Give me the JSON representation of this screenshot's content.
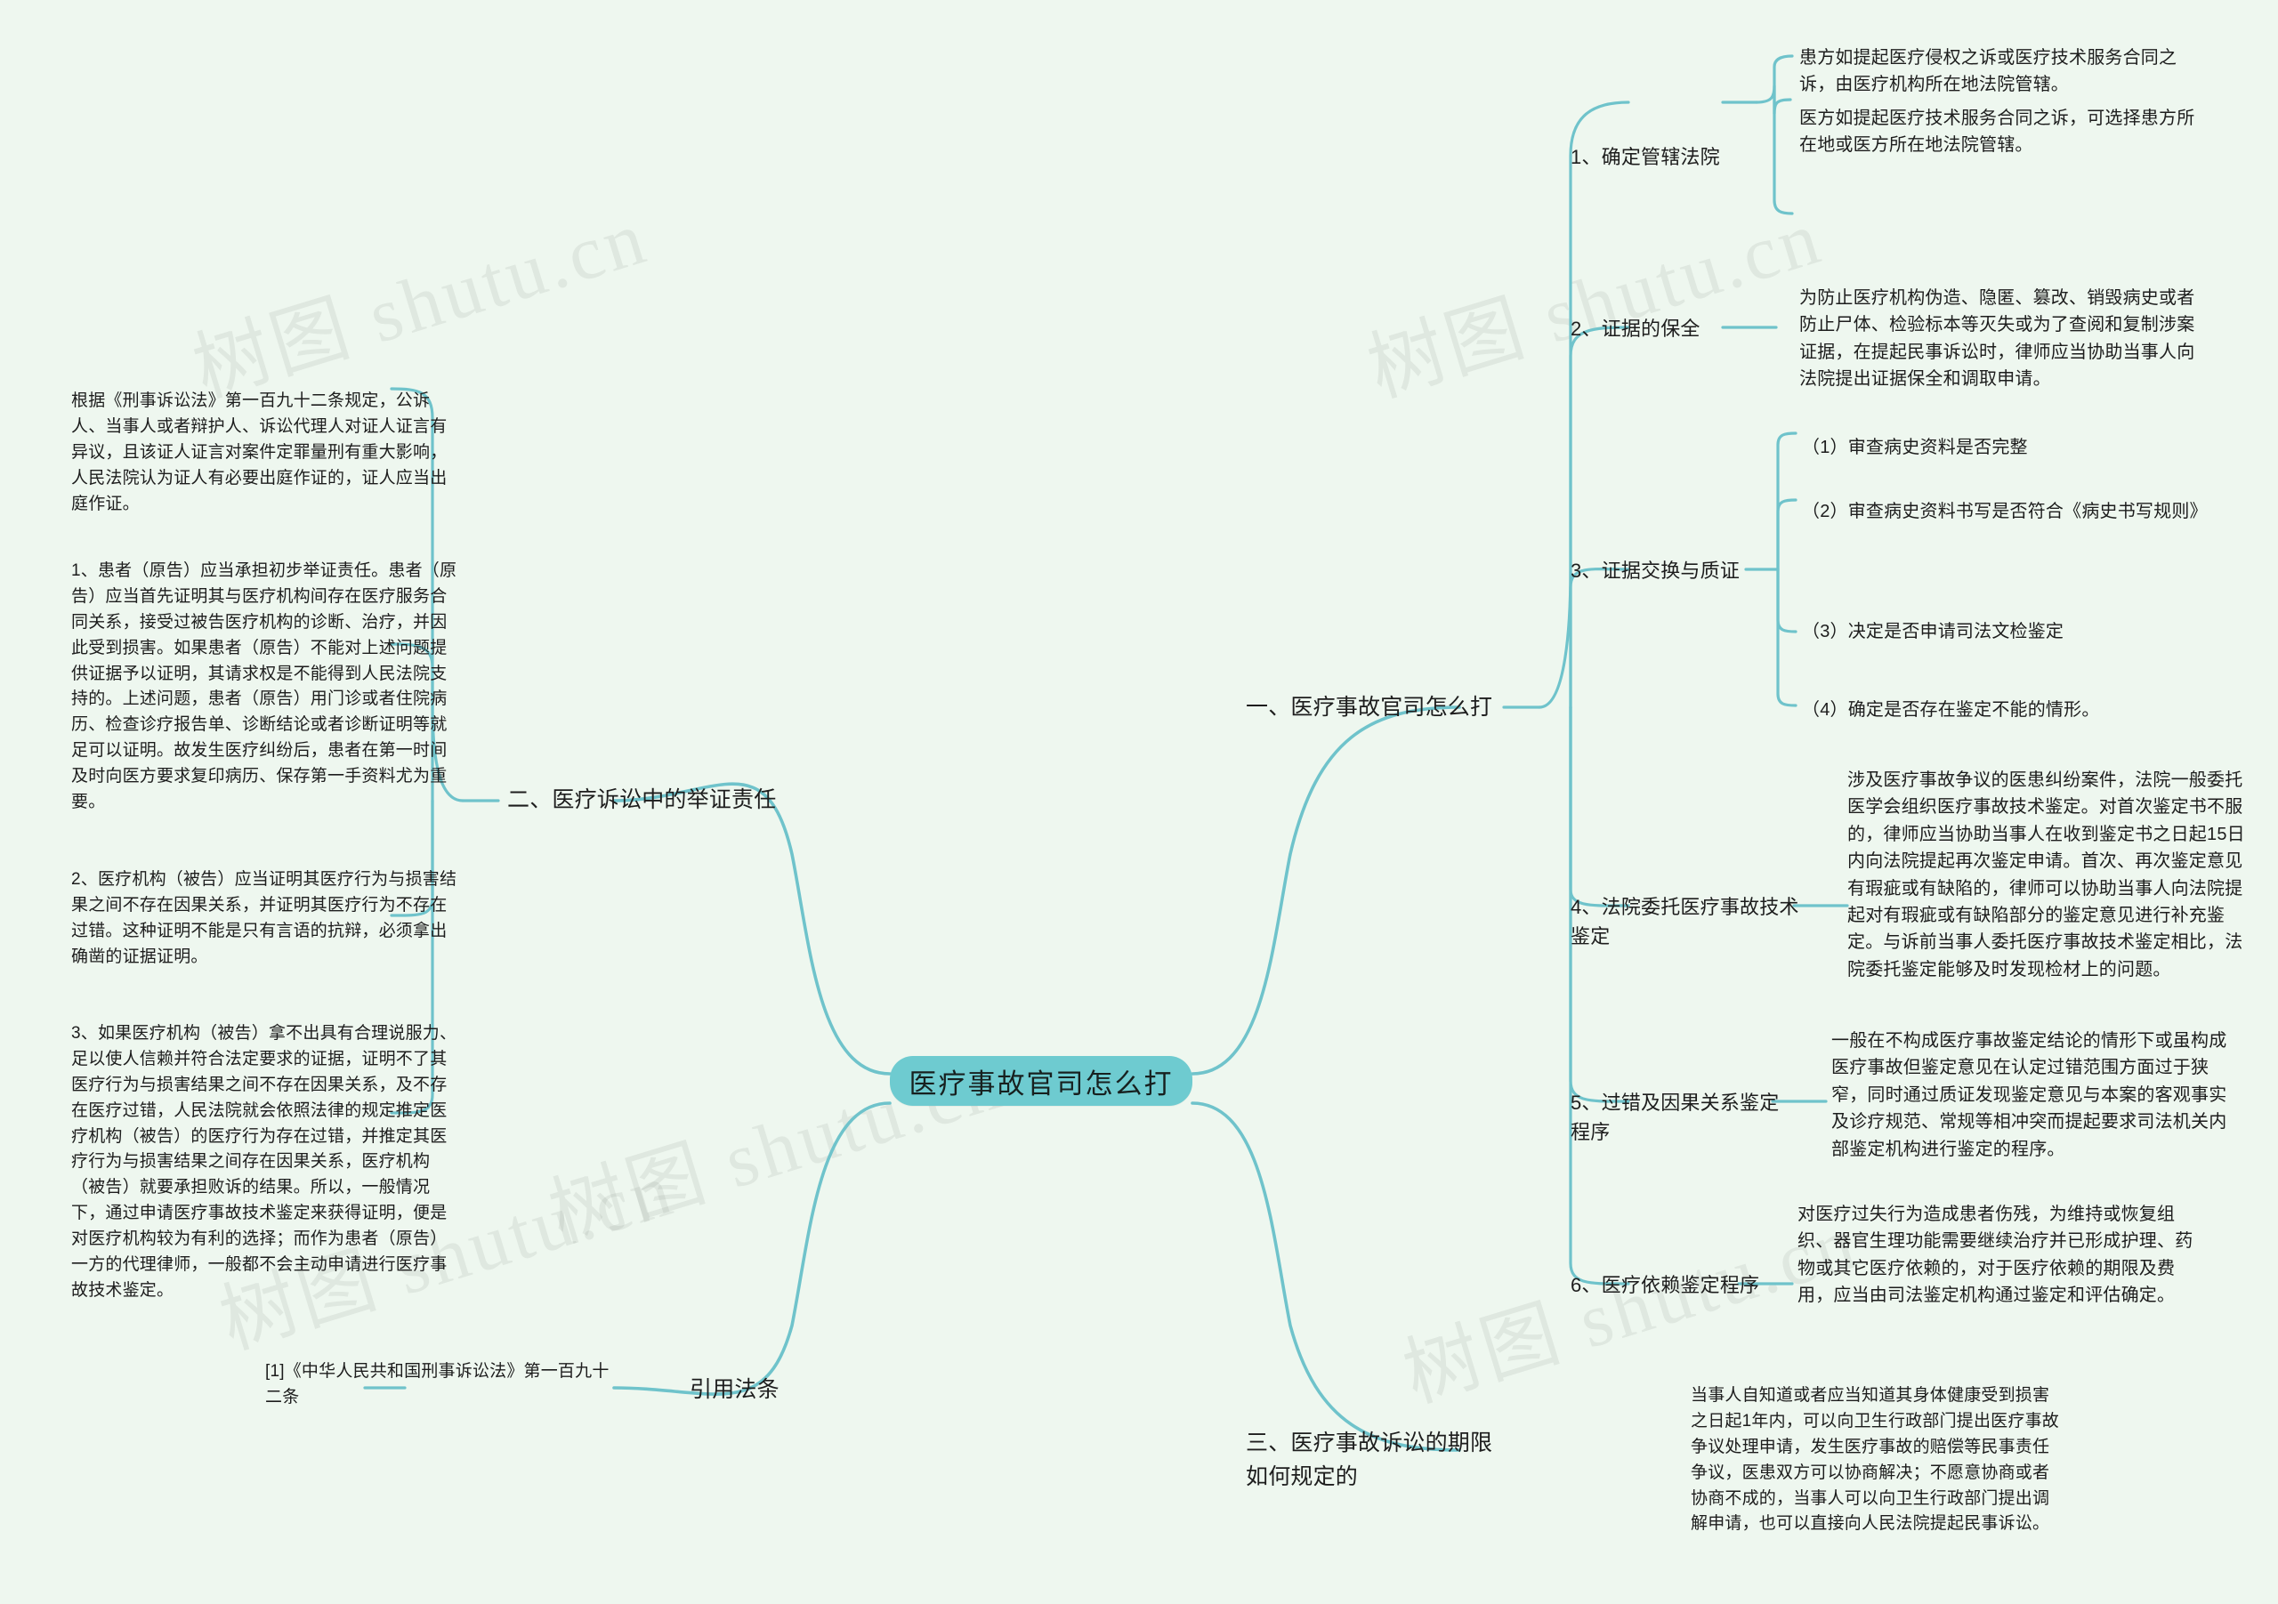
{
  "theme": {
    "background": "#eef7ef",
    "branch_color": "#6fc3cb",
    "central_fill": "#6ecbd0",
    "text_color": "#1d1d1d"
  },
  "watermarks": [
    "树图 shutu.cn",
    "树图 shutu.cn",
    "树图 shutu.cn",
    "树图 shutu.cn",
    "树图 shutu.cn"
  ],
  "central": {
    "label": "医疗事故官司怎么打"
  },
  "branches": {
    "topic1": {
      "label": "一、医疗事故官司怎么打",
      "children": [
        {
          "label": "1、确定管辖法院",
          "details": [
            "患方如提起医疗侵权之诉或医疗技术服务合同之诉，由医疗机构所在地法院管辖。",
            "医方如提起医疗技术服务合同之诉，可选择患方所在地或医方所在地法院管辖。"
          ]
        },
        {
          "label": "2、证据的保全",
          "details": [
            "为防止医疗机构伪造、隐匿、篡改、销毁病史或者防止尸体、检验标本等灭失或为了查阅和复制涉案证据，在提起民事诉讼时，律师应当协助当事人向法院提出证据保全和调取申请。"
          ]
        },
        {
          "label": "3、证据交换与质证",
          "details": [
            "（1）审查病史资料是否完整",
            "（2）审查病史资料书写是否符合《病史书写规则》",
            "（3）决定是否申请司法文检鉴定",
            "（4）确定是否存在鉴定不能的情形。"
          ]
        },
        {
          "label": "4、法院委托医疗事故技术鉴定",
          "details": [
            "涉及医疗事故争议的医患纠纷案件，法院一般委托医学会组织医疗事故技术鉴定。对首次鉴定书不服的，律师应当协助当事人在收到鉴定书之日起15日内向法院提起再次鉴定申请。首次、再次鉴定意见有瑕疵或有缺陷的，律师可以协助当事人向法院提起对有瑕疵或有缺陷部分的鉴定意见进行补充鉴定。与诉前当事人委托医疗事故技术鉴定相比，法院委托鉴定能够及时发现检材上的问题。"
          ]
        },
        {
          "label": "5、过错及因果关系鉴定程序",
          "details": [
            "一般在不构成医疗事故鉴定结论的情形下或虽构成医疗事故但鉴定意见在认定过错范围方面过于狭窄，同时通过质证发现鉴定意见与本案的客观事实及诊疗规范、常规等相冲突而提起要求司法机关内部鉴定机构进行鉴定的程序。"
          ]
        },
        {
          "label": "6、医疗依赖鉴定程序",
          "details": [
            "对医疗过失行为造成患者伤残，为维持或恢复组织、器官生理功能需要继续治疗并已形成护理、药物或其它医疗依赖的，对于医疗依赖的期限及费用，应当由司法鉴定机构通过鉴定和评估确定。"
          ]
        }
      ]
    },
    "topic2": {
      "label": "二、医疗诉讼中的举证责任",
      "details": [
        "根据《刑事诉讼法》第一百九十二条规定，公诉人、当事人或者辩护人、诉讼代理人对证人证言有异议，且该证人证言对案件定罪量刑有重大影响，人民法院认为证人有必要出庭作证的，证人应当出庭作证。",
        "1、患者（原告）应当承担初步举证责任。患者（原告）应当首先证明其与医疗机构间存在医疗服务合同关系，接受过被告医疗机构的诊断、治疗，并因此受到损害。如果患者（原告）不能对上述问题提供证据予以证明，其请求权是不能得到人民法院支持的。上述问题，患者（原告）用门诊或者住院病历、检查诊疗报告单、诊断结论或者诊断证明等就足可以证明。故发生医疗纠纷后，患者在第一时间及时向医方要求复印病历、保存第一手资料尤为重要。",
        "2、医疗机构（被告）应当证明其医疗行为与损害结果之间不存在因果关系，并证明其医疗行为不存在过错。这种证明不能是只有言语的抗辩，必须拿出确凿的证据证明。",
        "3、如果医疗机构（被告）拿不出具有合理说服力、足以使人信赖并符合法定要求的证据，证明不了其医疗行为与损害结果之间不存在因果关系，及不存在医疗过错，人民法院就会依照法律的规定推定医疗机构（被告）的医疗行为存在过错，并推定其医疗行为与损害结果之间存在因果关系，医疗机构（被告）就要承担败诉的结果。所以，一般情况下，通过申请医疗事故技术鉴定来获得证明，便是对医疗机构较为有利的选择；而作为患者（原告）一方的代理律师，一般都不会主动申请进行医疗事故技术鉴定。"
      ]
    },
    "topic3": {
      "label": "三、医疗事故诉讼的期限如何规定的",
      "details": [
        "当事人自知道或者应当知道其身体健康受到损害之日起1年内，可以向卫生行政部门提出医疗事故争议处理申请，发生医疗事故的赔偿等民事责任争议，医患双方可以协商解决；不愿意协商或者协商不成的，当事人可以向卫生行政部门提出调解申请，也可以直接向人民法院提起民事诉讼。"
      ]
    },
    "citation": {
      "label": "引用法条",
      "details": [
        "[1]《中华人民共和国刑事诉讼法》第一百九十二条"
      ]
    }
  }
}
